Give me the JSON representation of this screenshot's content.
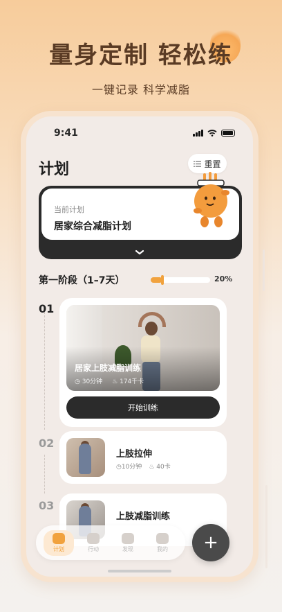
{
  "promo": {
    "title": "量身定制 轻松练",
    "subtitle": "一键记录 科学减脂"
  },
  "status": {
    "time": "9:41"
  },
  "header": {
    "title": "计划",
    "reset_label": "重置"
  },
  "current_plan": {
    "label": "当前计划",
    "name": "居家综合减脂计划"
  },
  "stage": {
    "title": "第一阶段（1–7天）",
    "progress": 0.2,
    "progress_label": "20%"
  },
  "days": [
    {
      "num": "01",
      "title": "居家上肢减脂训练",
      "duration": "30分钟",
      "calories": "174千卡",
      "button_label": "开始训练"
    },
    {
      "num": "02",
      "title": "上肢拉伸",
      "duration": "10分钟",
      "calories": "40卡"
    },
    {
      "num": "03",
      "title": "上肢减脂训练"
    }
  ],
  "tabbar": {
    "tabs": [
      {
        "label": "计划",
        "icon": "calendar-icon",
        "active": true
      },
      {
        "label": "行动",
        "icon": "action-icon",
        "active": false
      },
      {
        "label": "发现",
        "icon": "discover-icon",
        "active": false
      },
      {
        "label": "我的",
        "icon": "profile-icon",
        "active": false
      }
    ],
    "fab_icon": "plus-icon"
  },
  "colors": {
    "accent": "#f1a23e",
    "dark": "#2b2b2b",
    "title_brown": "#5a3b24"
  }
}
